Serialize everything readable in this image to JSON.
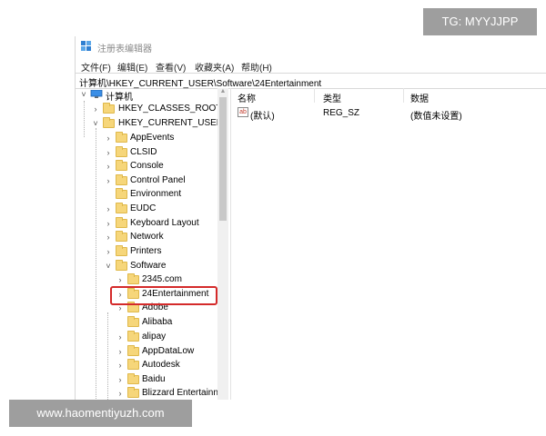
{
  "window": {
    "title": "注册表编辑器",
    "menu": [
      "文件(F)",
      "编辑(E)",
      "查看(V)",
      "收藏夹(A)",
      "帮助(H)"
    ],
    "address": "计算机\\HKEY_CURRENT_USER\\Software\\24Entertainment"
  },
  "tree": {
    "root": "计算机",
    "hives": [
      "HKEY_CLASSES_ROOT",
      "HKEY_CURRENT_USER"
    ],
    "hkcu_children": [
      "AppEvents",
      "CLSID",
      "Console",
      "Control Panel",
      "Environment",
      "EUDC",
      "Keyboard Layout",
      "Network",
      "Printers",
      "Software"
    ],
    "software_children": [
      "2345.com",
      "24Entertainment",
      "Adobe",
      "Alibaba",
      "alipay",
      "AppDataLow",
      "Autodesk",
      "Baidu",
      "Blizzard Entertainn"
    ],
    "selected": "24Entertainment"
  },
  "values_pane": {
    "columns": [
      "名称",
      "类型",
      "数据"
    ],
    "rows": [
      {
        "name": "(默认)",
        "type": "REG_SZ",
        "data": "(数值未设置)"
      }
    ]
  },
  "watermarks": {
    "tg": "TG: MYYJJPP",
    "url": "www.haomentiyuzh.com"
  },
  "colors": {
    "highlight_border": "#d42a2a",
    "folder": "#f6d67a",
    "badge_bg": "#9e9e9e"
  },
  "icons": {
    "title": "registry-editor-icon",
    "root": "computer-icon",
    "folder": "folder-icon",
    "value": "string-value-icon"
  }
}
